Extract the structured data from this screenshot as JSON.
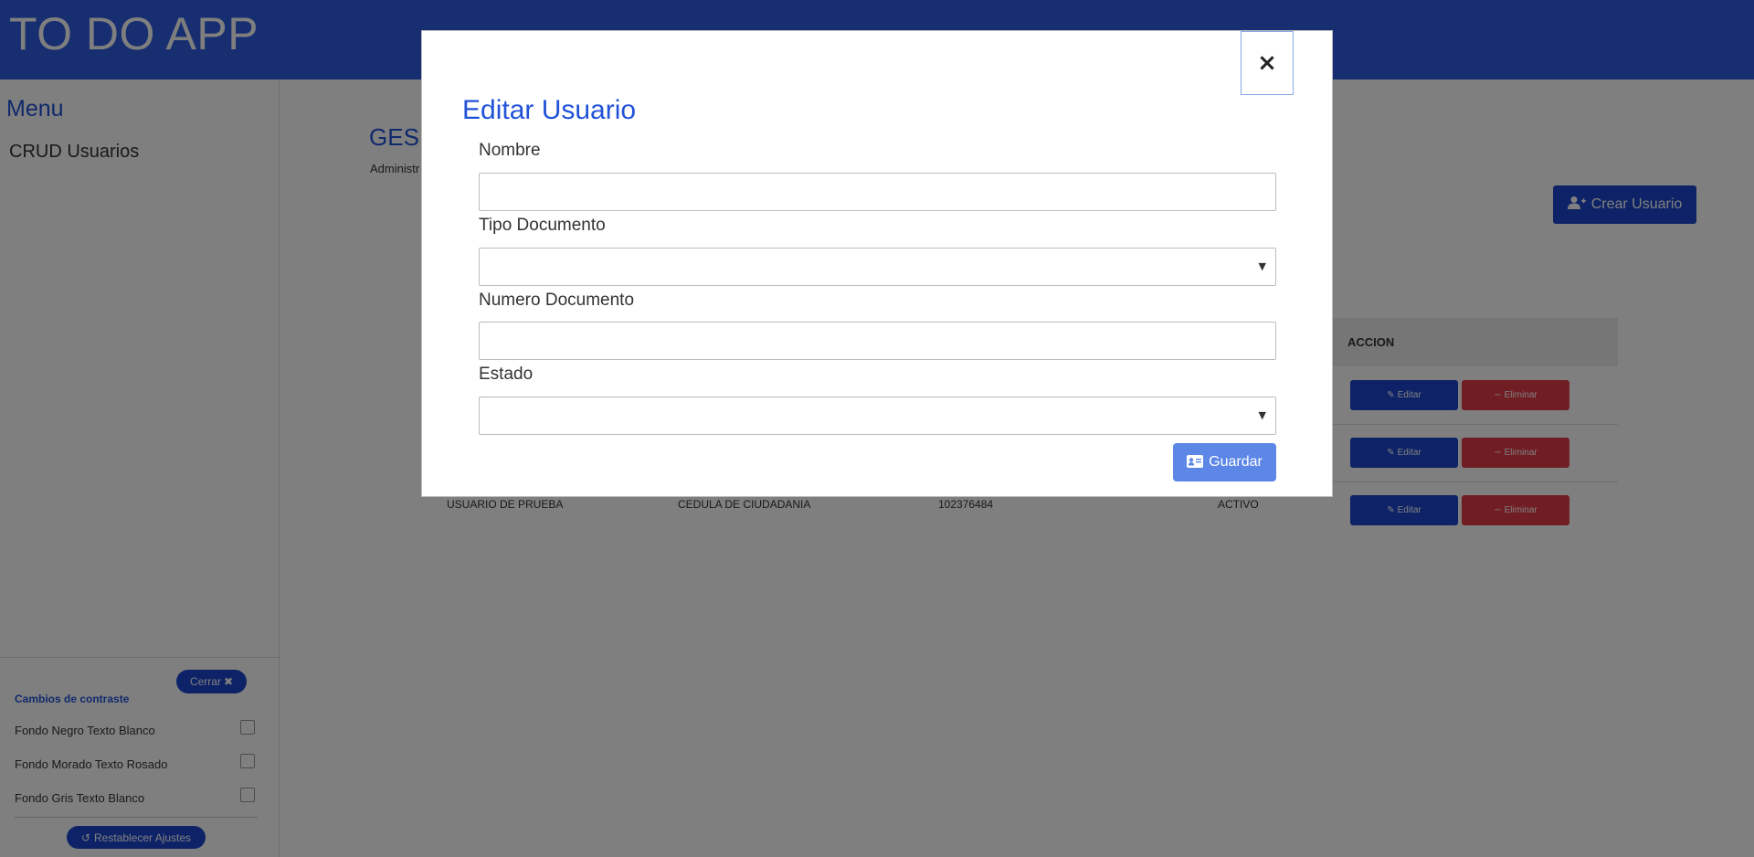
{
  "header": {
    "title": "TO DO APP"
  },
  "sidebar": {
    "menu_title": "Menu",
    "items": [
      {
        "label": "CRUD Usuarios"
      }
    ]
  },
  "accessibility_panel": {
    "close_label": "Cerrar",
    "section_title": "Cambios de contraste",
    "options": [
      {
        "label": "Fondo Negro Texto Blanco",
        "checked": false
      },
      {
        "label": "Fondo Morado Texto Rosado",
        "checked": false
      },
      {
        "label": "Fondo Gris Texto Blanco",
        "checked": false
      }
    ],
    "reset_label": "Restablecer Ajustes"
  },
  "main": {
    "heading_visible": "GES",
    "subheading_visible": "Administr",
    "create_button_label": "Crear Usuario",
    "table": {
      "visible_header": "ACCION",
      "row_actions": {
        "edit_label": "Editar",
        "delete_label": "Eliminar"
      },
      "visible_row": {
        "nombre": "USUARIO DE PRUEBA",
        "tipo_documento": "CEDULA DE CIUDADANIA",
        "numero_documento": "102376484",
        "estado": "ACTIVO"
      }
    }
  },
  "modal": {
    "close_symbol": "×",
    "title": "Editar Usuario",
    "fields": {
      "nombre": {
        "label": "Nombre",
        "value": ""
      },
      "tipo_documento": {
        "label": "Tipo Documento",
        "value": ""
      },
      "numero_documento": {
        "label": "Numero Documento",
        "value": ""
      },
      "estado": {
        "label": "Estado",
        "value": ""
      }
    },
    "save_label": "Guardar"
  },
  "colors": {
    "header_bg": "#2f5ce0",
    "accent_blue": "#1c46cf",
    "title_blue": "#2152d8",
    "danger_red": "#e23b48",
    "save_button": "#5d87e6",
    "overlay": "rgba(0,0,0,0.5)"
  },
  "icons": {
    "close": "close-icon",
    "add_user": "user-plus-icon",
    "edit_user": "user-edit-icon",
    "delete_user": "user-minus-icon",
    "save": "id-card-icon",
    "reset": "undo-icon"
  }
}
